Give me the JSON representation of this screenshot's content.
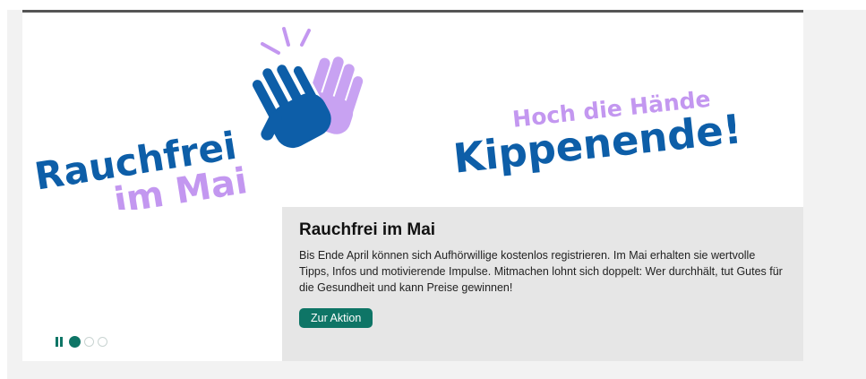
{
  "banner": {
    "logo_line1": "Rauchfrei",
    "logo_line2": "im Mai",
    "slogan_line1": "Hoch die Hände",
    "slogan_line2": "Kippenende!",
    "colors": {
      "blue": "#0d5ea8",
      "purple": "#c397f0",
      "lavender_hand": "#c8a2f2"
    }
  },
  "slide": {
    "title": "Rauchfrei im Mai",
    "text": "Bis Ende April können sich Aufhörwillige kostenlos registrieren. Im Mai erhalten sie wertvolle Tipps, Infos und motivierende Impulse. Mitmachen lohnt sich doppelt: Wer durchhält, tut Gutes für die Gesundheit und kann Preise gewinnen!",
    "cta_label": "Zur Aktion"
  },
  "carousel": {
    "pause_icon": "pause-icon",
    "slide_count": 3,
    "active_index": 1,
    "accent_color": "#0e7566"
  }
}
